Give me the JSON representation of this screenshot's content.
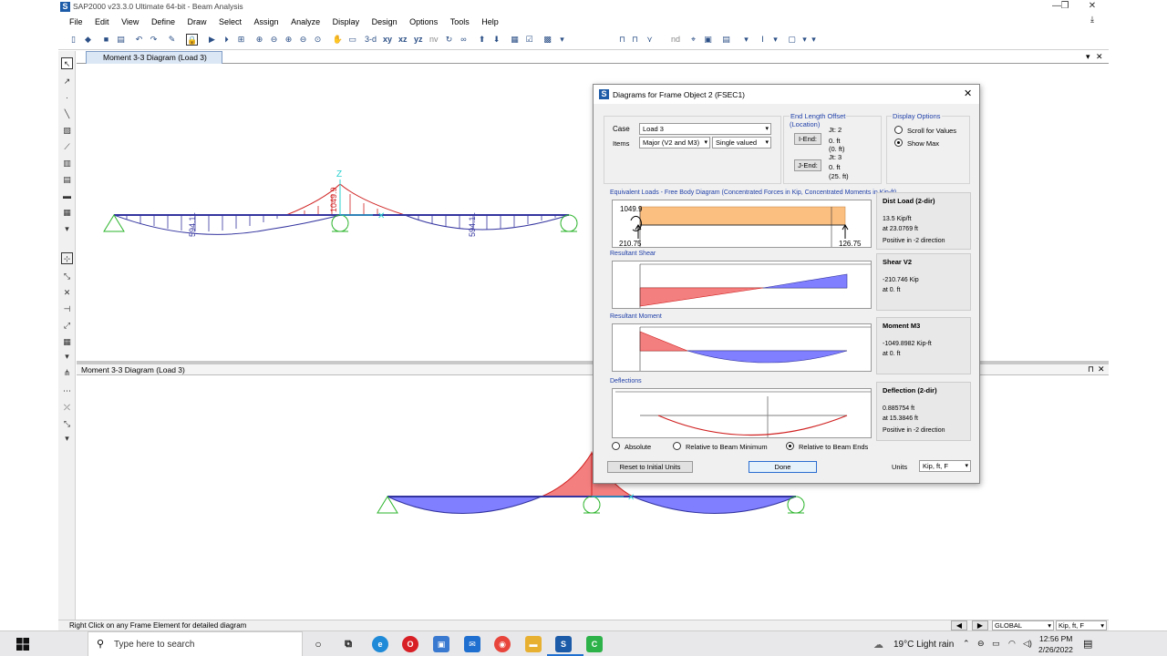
{
  "window": {
    "title": "SAP2000 v23.3.0 Ultimate 64-bit - Beam Analysis"
  },
  "menu": [
    "File",
    "Edit",
    "View",
    "Define",
    "Draw",
    "Select",
    "Assign",
    "Analyze",
    "Display",
    "Design",
    "Options",
    "Tools",
    "Help"
  ],
  "toolbar": {
    "view_3d": "3-d",
    "view_xy": "xy",
    "view_xz": "xz",
    "view_yz": "yz",
    "view_nv": "nv",
    "nd": "nd"
  },
  "top_pane": {
    "tab_label": "Moment 3-3 Diagram (Load 3)",
    "labels": {
      "support_moment": "1049.9",
      "span_moment_left": "594.11",
      "span_moment_right": "594.11",
      "axis_z": "Z"
    }
  },
  "bottom_pane": {
    "title": "Moment 3-3 Diagram (Load 3)"
  },
  "status": {
    "message": "Right Click on any Frame Element for detailed diagram",
    "coord_system": "GLOBAL",
    "units": "Kip, ft, F"
  },
  "dialog": {
    "title": "Diagrams for Frame Object 2  (FSEC1)",
    "case_label": "Case",
    "case_value": "Load 3",
    "items_label": "Items",
    "items_value": "Major (V2 and M3)",
    "items_mode": "Single valued",
    "end_offset": {
      "title_line1": "End Length Offset",
      "title_line2": "(Location)",
      "iend_button": "I-End:",
      "jend_button": "J-End:",
      "iend_jt": "Jt:  2",
      "iend_offset": "0.  ft",
      "iend_location": "(0.  ft)",
      "jend_jt": "Jt:  3",
      "jend_offset": "0.  ft",
      "jend_location": "(25.  ft)"
    },
    "display_options": {
      "title": "Display Options",
      "scroll": "Scroll for Values",
      "show_max": "Show Max",
      "selected": "show_max"
    },
    "fbd": {
      "title": "Equivalent Loads - Free Body Diagram  (Concentrated Forces in Kip, Concentrated Moments in Kip-ft)",
      "moment_label": "1049.9",
      "left_reaction": "210.75",
      "right_reaction": "126.75",
      "side_title": "Dist Load (2-dir)",
      "side_value": "13.5 Kip/ft",
      "side_at": "at 23.0769 ft",
      "side_note": "Positive in -2 direction"
    },
    "shear": {
      "title": "Resultant Shear",
      "side_title": "Shear V2",
      "side_value": "-210.746 Kip",
      "side_at": "at 0.  ft"
    },
    "moment": {
      "title": "Resultant Moment",
      "side_title": "Moment M3",
      "side_value": "-1049.8982 Kip-ft",
      "side_at": "at 0.  ft"
    },
    "deflection": {
      "title": "Deflections",
      "side_title": "Deflection (2-dir)",
      "side_value": "0.885754 ft",
      "side_at": "at 15.3846 ft",
      "side_note": "Positive in -2 direction",
      "radio_absolute": "Absolute",
      "radio_min": "Relative to Beam Minimum",
      "radio_ends": "Relative to Beam Ends",
      "selected": "ends"
    },
    "reset_button": "Reset to Initial Units",
    "done_button": "Done",
    "units_label": "Units",
    "units_value": "Kip, ft, F"
  },
  "colors": {
    "negative_fill": "#f47f7f",
    "positive_fill": "#7f7fff",
    "load_fill": "#fbbf80",
    "beam": "#3434a0",
    "support": "#2ab32a",
    "accent": "#1c5ba8"
  },
  "taskbar": {
    "search_placeholder": "Type here to search",
    "weather": "19°C  Light rain",
    "time": "12:56 PM",
    "date": "2/26/2022"
  }
}
